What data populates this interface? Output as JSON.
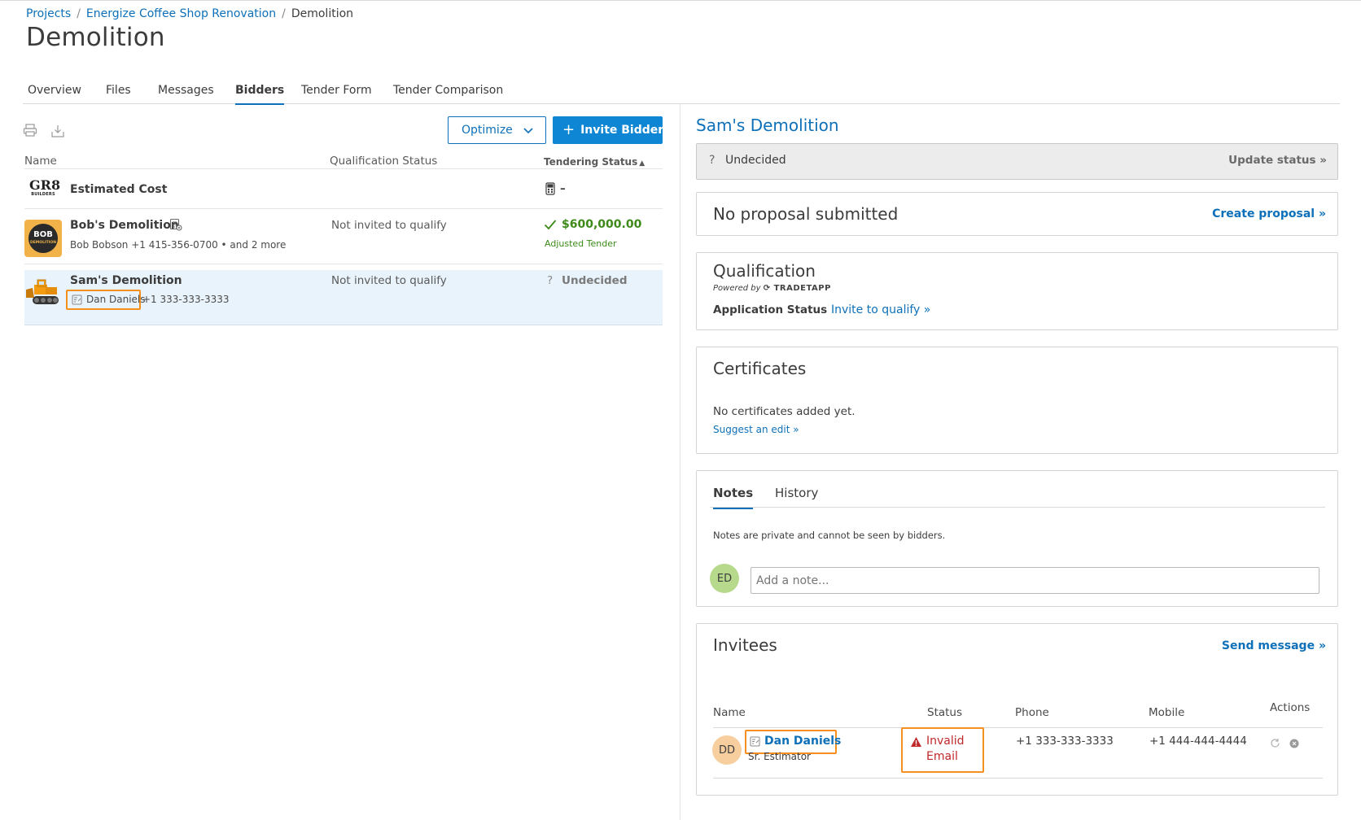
{
  "breadcrumb": {
    "items": [
      "Projects",
      "Energize Coffee Shop Renovation"
    ],
    "current": "Demolition"
  },
  "page": {
    "title": "Demolition"
  },
  "tabs": [
    "Overview",
    "Files",
    "Messages",
    "Bidders",
    "Tender Form",
    "Tender Comparison"
  ],
  "active_tab": "Bidders",
  "toolbar": {
    "optimize_label": "Optimize",
    "invite_label": "Invite Bidders",
    "print_icon": "printer-icon",
    "export_icon": "download-icon"
  },
  "table": {
    "headers": {
      "name": "Name",
      "qualification": "Qualification Status",
      "tendering": "Tendering Status"
    },
    "rows": [
      {
        "name": "Estimated Cost",
        "logo_text": "GR8",
        "logo_sub": "BUILDERS",
        "tendering": "–"
      },
      {
        "name": "Bob's Demolition",
        "logo_text": "BOB",
        "logo_sub": "DEMOLITION",
        "contact": "Bob Bobson +1 415-356-0700 • and 2 more",
        "qualification": "Not invited to qualify",
        "tendering": "$600,000.00",
        "tendering_note": "Adjusted Tender"
      },
      {
        "name": "Sam's Demolition",
        "contact_name": "Dan Daniels",
        "contact_phone": "+1 333-333-3333",
        "qualification": "Not invited to qualify",
        "tendering": "Undecided"
      }
    ]
  },
  "detail": {
    "title": "Sam's Demolition",
    "status": "Undecided",
    "update_status": "Update status »",
    "proposal": {
      "title": "No proposal submitted",
      "link": "Create proposal »"
    },
    "qualification": {
      "title": "Qualification",
      "powered_by": "Powered by",
      "brand": "TRADETAPP",
      "app_status_label": "Application Status",
      "invite_link": "Invite to qualify »"
    },
    "certificates": {
      "title": "Certificates",
      "empty": "No certificates added yet.",
      "suggest": "Suggest an edit »"
    },
    "notes": {
      "tabs": [
        "Notes",
        "History"
      ],
      "info": "Notes are private and cannot be seen by bidders.",
      "avatar": "ED",
      "placeholder": "Add a note..."
    },
    "invitees": {
      "title": "Invitees",
      "send_message": "Send message »",
      "headers": {
        "name": "Name",
        "status": "Status",
        "phone": "Phone",
        "mobile": "Mobile",
        "actions": "Actions"
      },
      "rows": [
        {
          "initials": "DD",
          "name": "Dan Daniels",
          "role": "Sr. Estimator",
          "status_line1": "Invalid",
          "status_line2": "Email",
          "phone": "+1 333-333-3333",
          "mobile": "+1 444-444-4444"
        }
      ]
    }
  },
  "colors": {
    "brand_blue": "#0e70b8",
    "button_blue": "#0e86d4",
    "success_green": "#3d8a19",
    "error_red": "#c0282a",
    "highlight_orange": "#f5901f",
    "avatar_green": "#b7d98c",
    "avatar_peach": "#f7cf9f"
  }
}
